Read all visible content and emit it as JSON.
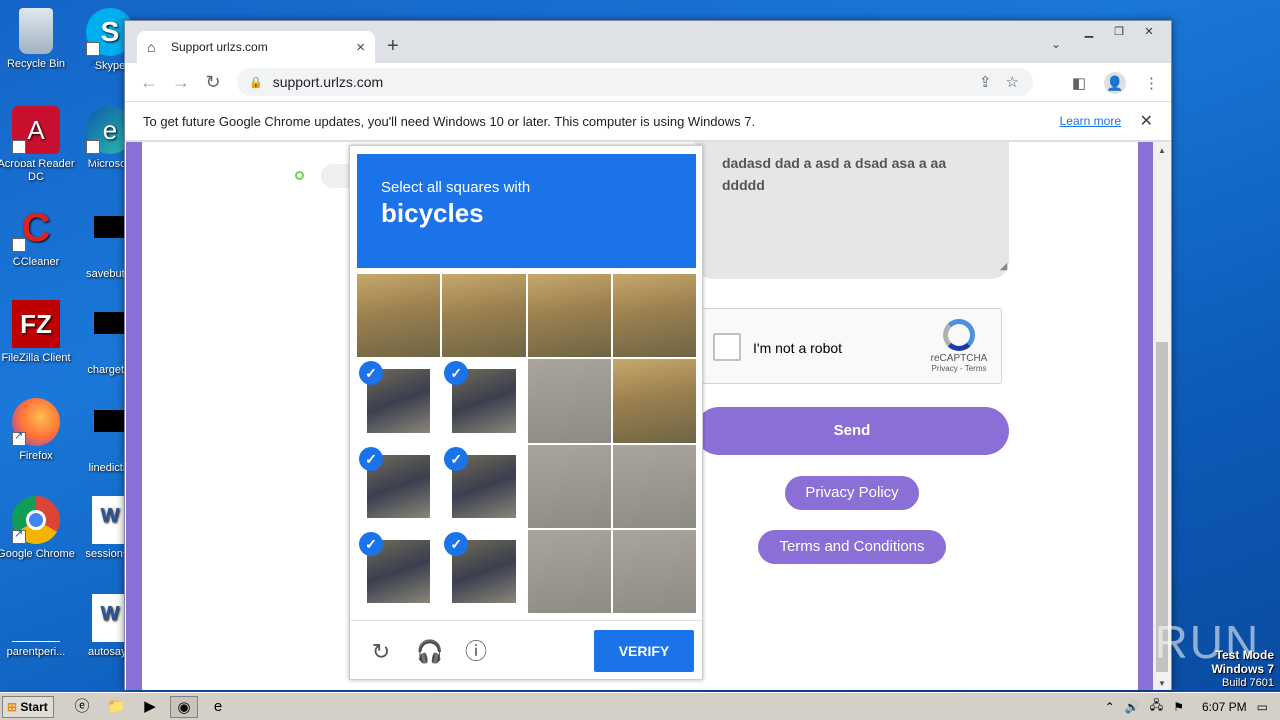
{
  "desktop": {
    "icons": [
      {
        "label": "Recycle Bin",
        "symbol": "🗑"
      },
      {
        "label": "Skype",
        "symbol": "S"
      },
      {
        "label": "Acrobat Reader DC",
        "symbol": "A"
      },
      {
        "label": "Microsoft",
        "symbol": "e"
      },
      {
        "label": "CCleaner",
        "symbol": "C"
      },
      {
        "label": "savebutto",
        "symbol": ""
      },
      {
        "label": "FileZilla Client",
        "symbol": "FZ"
      },
      {
        "label": "chargethi",
        "symbol": ""
      },
      {
        "label": "Firefox",
        "symbol": "🦊"
      },
      {
        "label": "linedictio",
        "symbol": ""
      },
      {
        "label": "Google Chrome",
        "symbol": "◉"
      },
      {
        "label": "sessionsu",
        "symbol": "W"
      },
      {
        "label": "parentperi...",
        "symbol": ""
      },
      {
        "label": "autosays",
        "symbol": "W"
      }
    ]
  },
  "browser": {
    "tab_title": "Support urlzs.com",
    "url": "support.urlzs.com",
    "infobar_text": "To get future Google Chrome updates, you'll need Windows 10 or later. This computer is using Windows 7.",
    "infobar_link": "Learn more"
  },
  "page": {
    "textarea_text": "dadasd  dad a asd a dsad asa a aa   ddddd",
    "recaptcha_label": "I'm not a robot",
    "recaptcha_brand": "reCAPTCHA",
    "recaptcha_terms": "Privacy - Terms",
    "send_label": "Send",
    "privacy_label": "Privacy Policy",
    "terms_label": "Terms and Conditions"
  },
  "challenge": {
    "instruction": "Select all squares with",
    "target": "bicycles",
    "selected_tiles": [
      5,
      6,
      9,
      10,
      13,
      14
    ],
    "verify_label": "VERIFY"
  },
  "taskbar": {
    "start_label": "Start",
    "clock": "6:07 PM"
  },
  "watermark": {
    "mode": "Test Mode",
    "os": "Windows 7",
    "build": "Build 7601",
    "brand": "ANY RUN"
  }
}
